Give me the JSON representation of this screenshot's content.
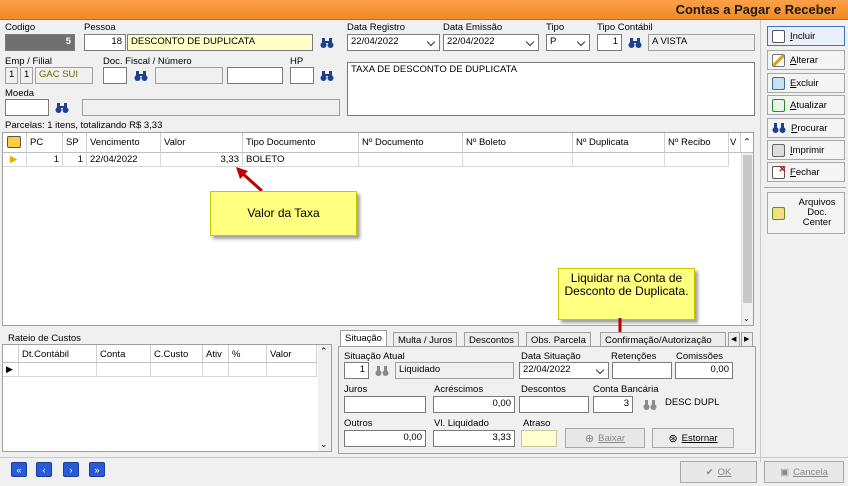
{
  "window": {
    "title": "Contas a Pagar e Receber"
  },
  "header": {
    "codigo_label": "Codigo",
    "codigo_value": "5",
    "pessoa_label": "Pessoa",
    "pessoa_code": "18",
    "pessoa_name": "DESCONTO DE DUPLICATA",
    "data_registro_label": "Data Registro",
    "data_registro_value": "22/04/2022",
    "data_emissao_label": "Data Emissão",
    "data_emissao_value": "22/04/2022",
    "tipo_label": "Tipo",
    "tipo_value": "P",
    "tipo_contabil_label": "Tipo Contábil",
    "tipo_contabil_code": "1",
    "tipo_contabil_name": "A VISTA",
    "emp_filial_label": "Emp / Filial",
    "emp_value": "1",
    "filial_value": "1",
    "filial_name": "GAC SUI",
    "doc_fiscal_label": "Doc. Fiscal / Número",
    "hp_label": "HP",
    "moeda_label": "Moeda",
    "observacao": "TAXA DE DESCONTO DE DUPLICATA"
  },
  "sidebar": {
    "buttons": [
      {
        "label": "Incluir",
        "u": "I",
        "rest": "ncluir"
      },
      {
        "label": "Alterar",
        "u": "A",
        "rest": "lterar"
      },
      {
        "label": "Excluir",
        "u": "E",
        "rest": "xcluir"
      },
      {
        "label": "Atualizar",
        "u": "A",
        "rest": "tualizar"
      },
      {
        "label": "Procurar",
        "u": "P",
        "rest": "rocurar"
      },
      {
        "label": "Imprimir",
        "u": "I",
        "rest": "mprimir"
      },
      {
        "label": "Fechar",
        "u": "F",
        "rest": "echar"
      }
    ],
    "docs_line1": "Arquivos",
    "docs_line2": "Doc.",
    "docs_line3": "Center"
  },
  "parcelas": {
    "summary": "Parcelas: 1 itens, totalizando R$ 3,33",
    "columns": [
      "PC",
      "SP",
      "Vencimento",
      "Valor",
      "Tipo Documento",
      "Nº Documento",
      "Nº Boleto",
      "Nº Duplicata",
      "Nº Recibo",
      "V"
    ],
    "rows": [
      {
        "pc": "1",
        "sp": "1",
        "vencimento": "22/04/2022",
        "valor": "3,33",
        "tipo": "BOLETO"
      }
    ]
  },
  "notes": {
    "valor_taxa": "Valor da Taxa",
    "liquidar": "Liquidar na Conta de Desconto de Duplicata."
  },
  "rateio": {
    "title": "Rateio de Custos",
    "columns": [
      "Dt.Contábil",
      "Conta",
      "C.Custo",
      "Ativ",
      "%",
      "Valor"
    ]
  },
  "tabs": [
    "Situação",
    "Multa / Juros",
    "Descontos",
    "Obs. Parcela",
    "Confirmação/Autorização"
  ],
  "situacao": {
    "situacao_atual_label": "Situação Atual",
    "situacao_code": "1",
    "situacao_name": "Liquidado",
    "data_situacao_label": "Data Situação",
    "data_situacao_value": "22/04/2022",
    "retencoes_label": "Retenções",
    "comissoes_label": "Comissões",
    "comissoes_value": "0,00",
    "juros_label": "Juros",
    "acrescimos_label": "Acréscimos",
    "acrescimos_value": "0,00",
    "descontos_label": "Descontos",
    "conta_bancaria_label": "Conta Bancária",
    "conta_bancaria_code": "3",
    "conta_bancaria_name": "DESC DUPL",
    "outros_label": "Outros",
    "outros_value": "0,00",
    "vl_liquidado_label": "Vl. Liquidado",
    "vl_liquidado_value": "3,33",
    "atraso_label": "Atraso",
    "baixar_label": "Baixar",
    "estornar_label": "Estornar"
  },
  "footer": {
    "ok_label": "OK",
    "cancela_label": "Cancela"
  }
}
